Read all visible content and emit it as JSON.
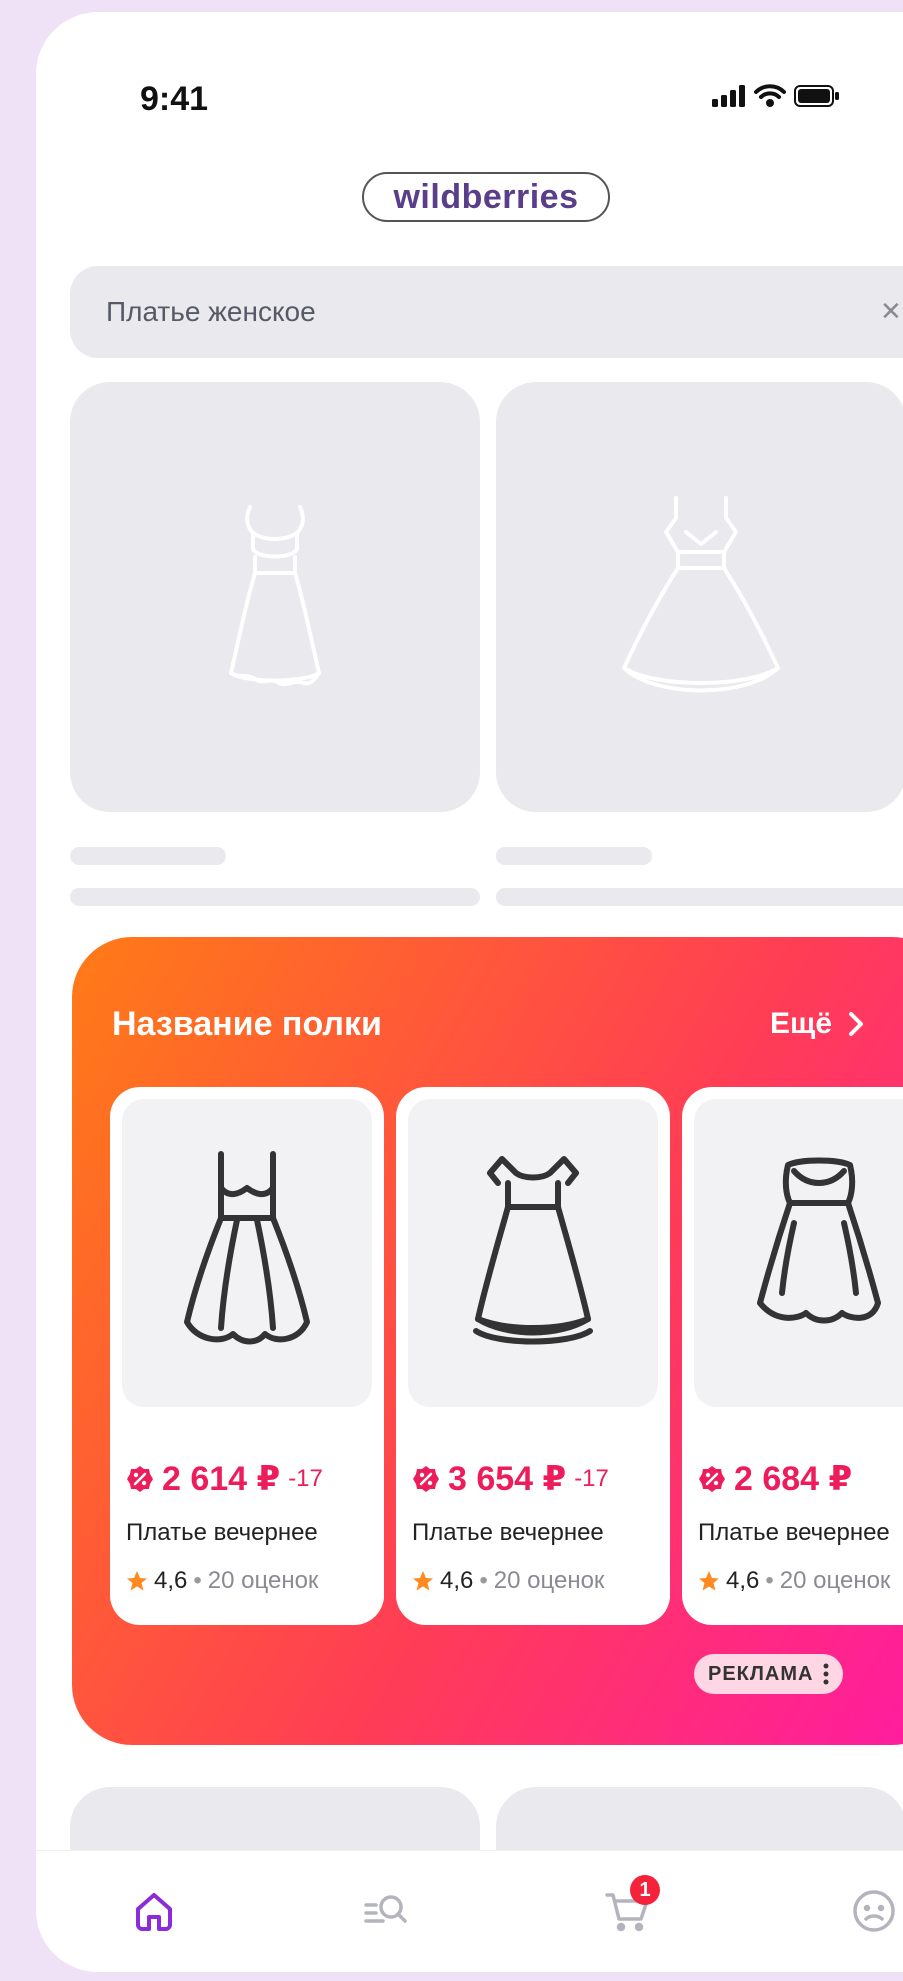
{
  "status_bar": {
    "time": "9:41",
    "icons": [
      "signal-icon",
      "wifi-icon",
      "battery-icon"
    ]
  },
  "logo": {
    "text": "wildberries"
  },
  "search": {
    "value": "Платье женское",
    "clear_icon": "close-icon"
  },
  "shelf": {
    "title": "Название полки",
    "more_label": "Ещё",
    "ad_label": "РЕКЛАМА",
    "products": [
      {
        "price": "2 614 ₽",
        "discount": "-17",
        "name": "Платье вечернее",
        "rating": "4,6",
        "reviews": "20 оценок"
      },
      {
        "price": "3 654 ₽",
        "discount": "-17",
        "name": "Платье вечернее",
        "rating": "4,6",
        "reviews": "20 оценок"
      },
      {
        "price": "2 684 ₽",
        "discount": "",
        "name": "Платье вечернее",
        "rating": "4,6",
        "reviews": "20 оценок"
      }
    ]
  },
  "bottom_nav": {
    "items": [
      "home-icon",
      "catalog-search-icon",
      "cart-icon",
      "profile-icon"
    ],
    "cart_count": "1"
  },
  "colors": {
    "accent_purple": "#8b2bd9",
    "price_red": "#ec1d5a",
    "shelf_gradient_start": "#ff7b16",
    "shelf_gradient_end": "#ff1aa4",
    "star_orange": "#ff8a1f",
    "skeleton": "#e9e9ee"
  }
}
